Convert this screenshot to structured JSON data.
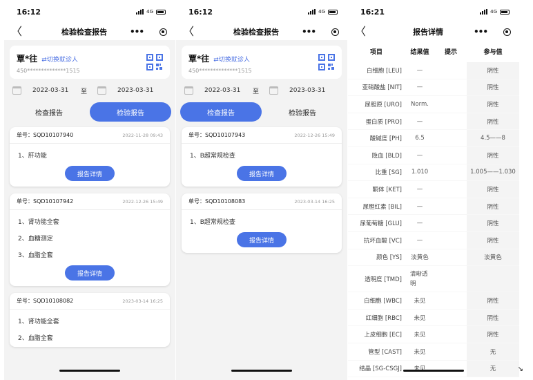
{
  "status": {
    "time1": "16:12",
    "time2": "16:12",
    "time3": "16:21",
    "network": "4G"
  },
  "nav": {
    "title_list": "检验检查报告",
    "title_detail": "报告详情",
    "back": "〈",
    "more": "•••"
  },
  "patient": {
    "name": "覃*往",
    "switch": "⇄切换就诊人",
    "id": "450**************1515"
  },
  "dates": {
    "start": "2022-03-31",
    "to": "至",
    "end": "2023-03-31"
  },
  "tabs": {
    "exam": "检查报告",
    "lab": "检验报告"
  },
  "order_prefix": "单号：",
  "detail_button": "报告详情",
  "list1": [
    {
      "no": "SQD10107940",
      "date": "2022-11-28 09:43",
      "items": [
        "1、肝功能"
      ]
    },
    {
      "no": "SQD10107942",
      "date": "2022-12-26 15:49",
      "items": [
        "1、肾功能全套",
        "2、血糖测定",
        "3、血脂全套"
      ]
    },
    {
      "no": "SQD10108082",
      "date": "2023-03-14 16:25",
      "items": [
        "1、肾功能全套",
        "2、血脂全套"
      ]
    }
  ],
  "list2": [
    {
      "no": "SQD10107943",
      "date": "2022-12-26 15:49",
      "items": [
        "1、B超常规检查"
      ]
    },
    {
      "no": "SQD10108083",
      "date": "2023-03-14 16:25",
      "items": [
        "1、B超常规检查"
      ]
    }
  ],
  "table": {
    "headers": [
      "项目",
      "结果值",
      "提示",
      "参与值"
    ],
    "rows": [
      [
        "白细胞 [LEU]",
        "—",
        "",
        "阴性"
      ],
      [
        "亚硝酸盐 [NIT]",
        "—",
        "",
        "阴性"
      ],
      [
        "尿胆原 [URO]",
        "Norm.",
        "",
        "阴性"
      ],
      [
        "蛋白质 [PRO]",
        "—",
        "",
        "阴性"
      ],
      [
        "酸碱度 [PH]",
        "6.5",
        "",
        "4.5——8"
      ],
      [
        "隐血 [BLD]",
        "—",
        "",
        "阴性"
      ],
      [
        "比重 [SG]",
        "1.010",
        "",
        "1.005——1.030"
      ],
      [
        "酮体 [KET]",
        "—",
        "",
        "阴性"
      ],
      [
        "尿胆红素 [BIL]",
        "—",
        "",
        "阴性"
      ],
      [
        "尿葡萄糖 [GLU]",
        "—",
        "",
        "阴性"
      ],
      [
        "抗坏血酸 [VC]",
        "—",
        "",
        "阴性"
      ],
      [
        "颜色 [YS]",
        "淡黄色",
        "",
        "淡黄色"
      ],
      [
        "透明度 [TMD]",
        "清晰透明",
        "",
        ""
      ],
      [
        "白细胞 [WBC]",
        "未见",
        "",
        "阴性"
      ],
      [
        "红细胞 [RBC]",
        "未见",
        "",
        "阴性"
      ],
      [
        "上皮细胞 [EC]",
        "未见",
        "",
        "阴性"
      ],
      [
        "管型 [CAST]",
        "未见",
        "",
        "无"
      ],
      [
        "结晶 [SG-CSGJ]",
        "未见",
        "",
        "无"
      ]
    ]
  },
  "corner_mark": "↘"
}
